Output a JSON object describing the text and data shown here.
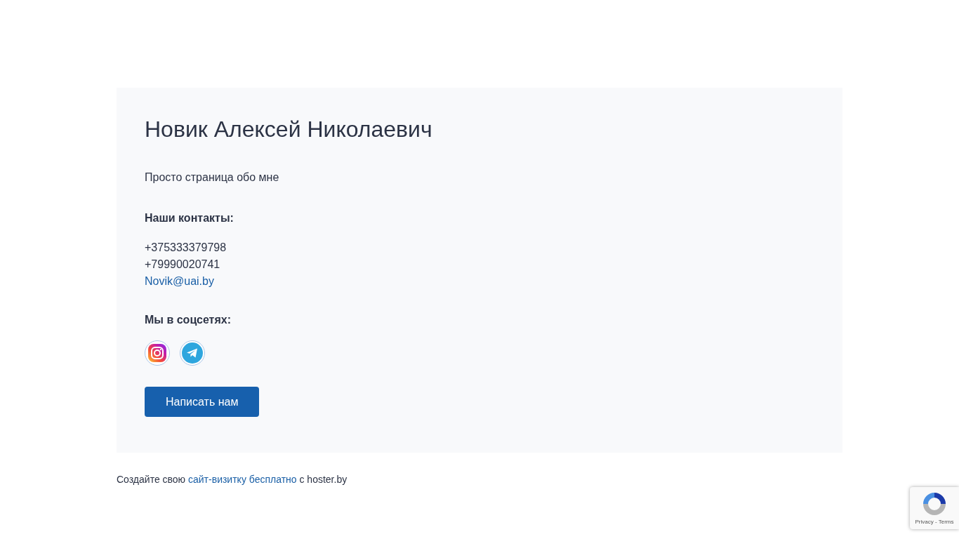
{
  "card": {
    "title": "Новик Алексей Николаевич",
    "subtitle": "Просто страница обо мне",
    "contacts_heading": "Наши контакты:",
    "phones": [
      "+375333379798",
      "+79990020741"
    ],
    "email": "Novik@uai.by",
    "social_heading": "Мы в соцсетях:",
    "socials": [
      {
        "kind": "instagram"
      },
      {
        "kind": "telegram"
      }
    ],
    "button": "Написать нам"
  },
  "footer": {
    "before": "Создайте свою",
    "link": "сайт-визитку бесплатно",
    "after": "с hoster.by"
  },
  "recaptcha": {
    "links": "Privacy - Terms"
  }
}
